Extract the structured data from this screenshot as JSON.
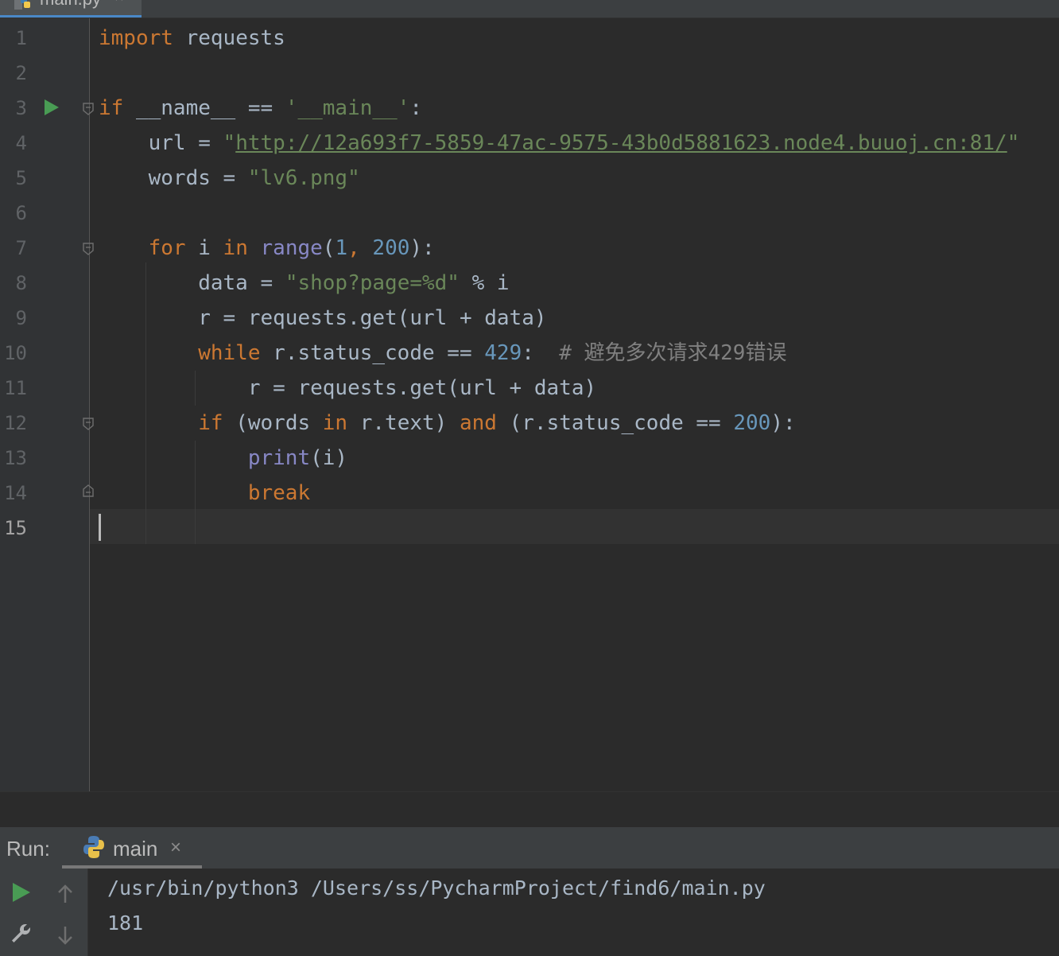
{
  "tab": {
    "label": "main.py",
    "close": "×"
  },
  "editor": {
    "line_numbers": [
      "1",
      "2",
      "3",
      "4",
      "5",
      "6",
      "7",
      "8",
      "9",
      "10",
      "11",
      "12",
      "13",
      "14",
      "15"
    ],
    "lines": {
      "l1": {
        "kw": "import",
        "rest": " requests"
      },
      "l3": {
        "kw": "if",
        "mid": " __name__ == ",
        "str": "'__main__'",
        "end": ":"
      },
      "l4": {
        "pre": "    url = ",
        "q1": "\"",
        "link": "http://12a693f7-5859-47ac-9575-43b0d5881623.node4.buuoj.cn:81/",
        "q2": "\""
      },
      "l5": {
        "pre": "    words = ",
        "str": "\"lv6.png\""
      },
      "l7": {
        "kw1": "    for",
        "mid1": " i ",
        "kw2": "in",
        "sp": " ",
        "bi": "range",
        "p1": "(",
        "n1": "1",
        "comma": ", ",
        "n2": "200",
        "end": "):"
      },
      "l8": {
        "pre": "        data = ",
        "str": "\"shop?page=%d\"",
        "end": " % i"
      },
      "l9": {
        "text": "        r = requests.get(url + data)"
      },
      "l10": {
        "kw": "        while",
        "mid": " r.status_code == ",
        "num": "429",
        "colon": ":",
        "cm": "  # 避免多次请求429错误"
      },
      "l11": {
        "text": "            r = requests.get(url + data)"
      },
      "l12": {
        "kw1": "        if",
        "p1": " (words ",
        "kw2": "in",
        "m1": " r.text) ",
        "kw3": "and",
        "m2": " (r.status_code == ",
        "num": "200",
        "end": "):"
      },
      "l13": {
        "bi": "            print",
        "rest": "(i)"
      },
      "l14": {
        "kw": "            break"
      }
    }
  },
  "run_panel": {
    "label": "Run:",
    "tab_label": "main",
    "tab_close": "×",
    "console": [
      "/usr/bin/python3 /Users/ss/PycharmProject/find6/main.py",
      "181"
    ]
  },
  "colors": {
    "background": "#2b2b2b",
    "keyword": "#cc7832",
    "string": "#6a8759",
    "number": "#6897bb",
    "builtin": "#8888c6",
    "comment": "#808080",
    "run_green": "#499c54"
  }
}
